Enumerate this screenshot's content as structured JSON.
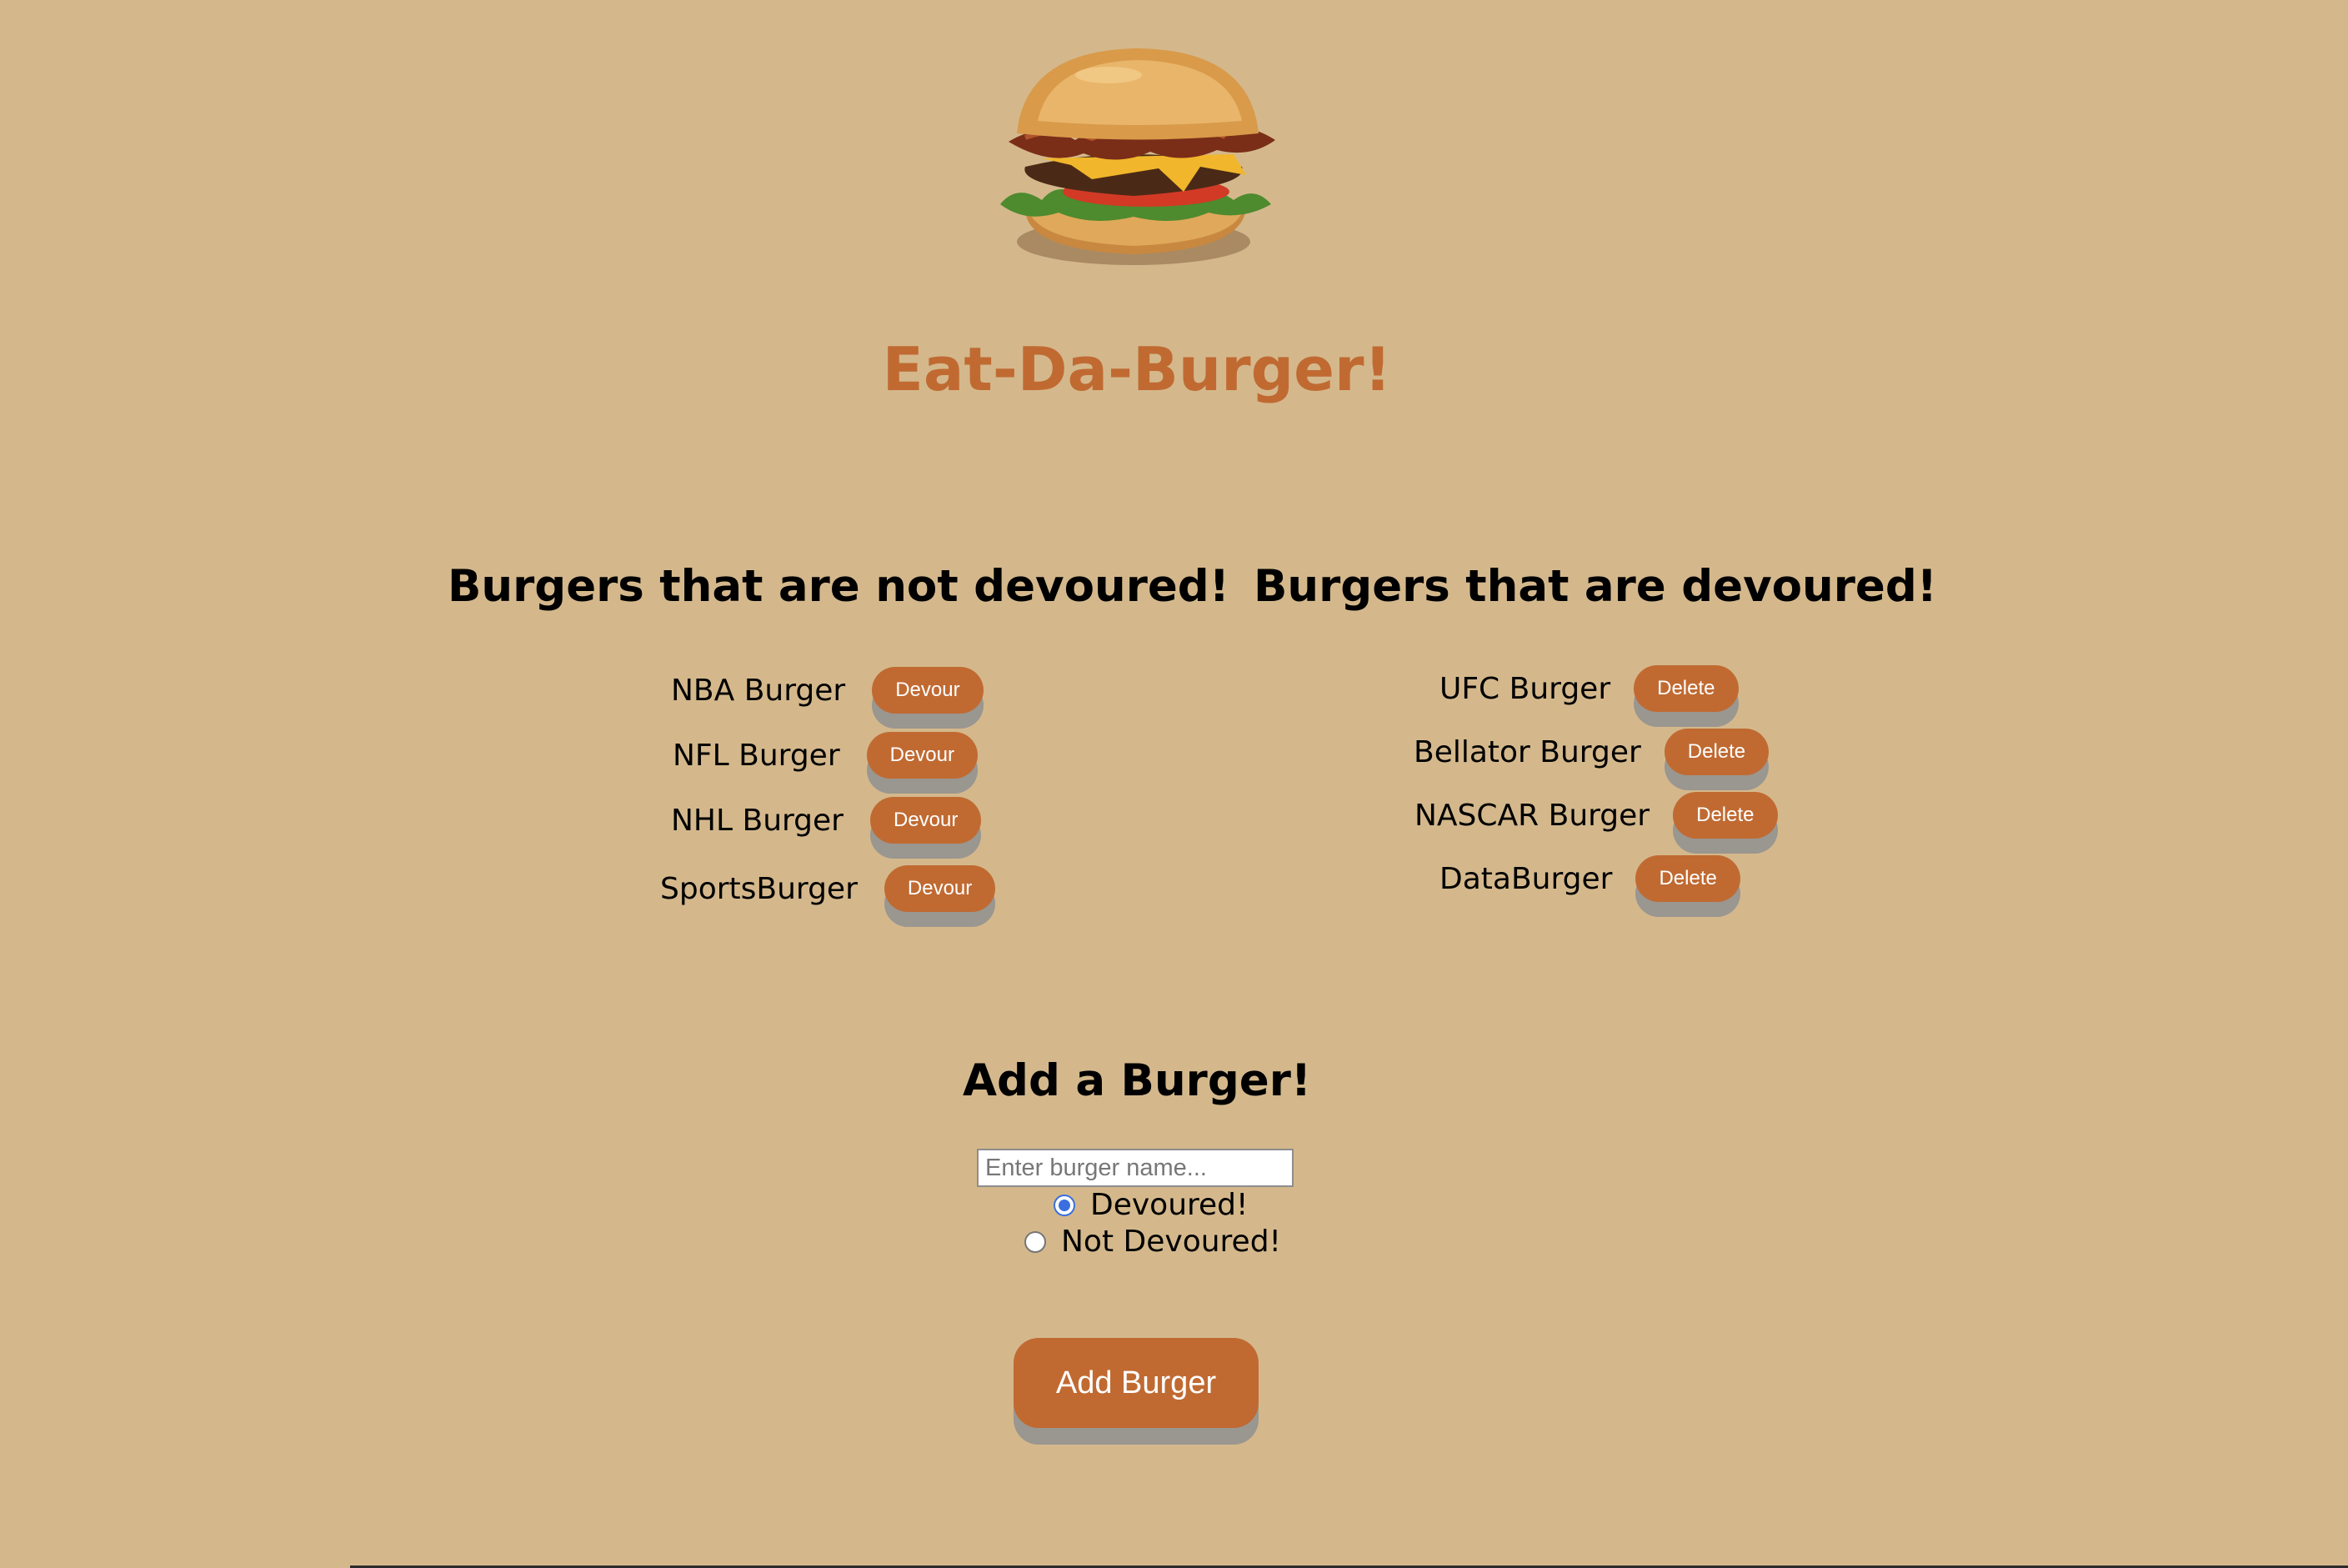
{
  "page": {
    "title": "Eat-Da-Burger!",
    "hero_image": "burger-image"
  },
  "columns": {
    "not_devoured": {
      "heading": "Burgers that are not devoured!",
      "button_label": "Devour",
      "items": [
        "NBA Burger",
        "NFL Burger",
        "NHL Burger",
        "SportsBurger"
      ]
    },
    "devoured": {
      "heading": "Burgers that are devoured!",
      "button_label": "Delete",
      "items": [
        "UFC Burger",
        "Bellator Burger",
        "NASCAR Burger",
        "DataBurger"
      ]
    }
  },
  "form": {
    "heading": "Add a Burger!",
    "input_placeholder": "Enter burger name...",
    "input_value": "",
    "radio_devoured_label": "Devoured!",
    "radio_not_devoured_label": "Not Devoured!",
    "selected": "Devoured!",
    "submit_label": "Add Burger"
  },
  "colors": {
    "background": "#d4b88c",
    "accent": "#c06a32",
    "button_shadow": "#9a9690"
  }
}
